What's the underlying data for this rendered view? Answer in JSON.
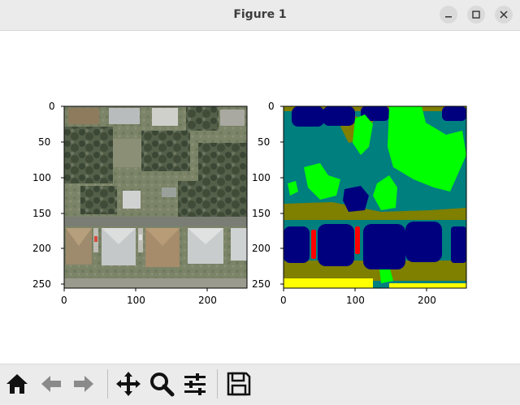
{
  "window": {
    "title": "Figure 1",
    "buttons": [
      "minimize",
      "maximize",
      "close"
    ]
  },
  "chart_data": [
    {
      "type": "image",
      "content": "aerial photo of residential neighborhood (houses, roofs, trees, lawns, road)",
      "x_ticks": [
        "0",
        "100",
        "200"
      ],
      "y_ticks": [
        "0",
        "50",
        "100",
        "150",
        "200",
        "250"
      ],
      "xlim": [
        0,
        255
      ],
      "ylim": [
        255,
        0
      ]
    },
    {
      "type": "image",
      "content": "semantic segmentation label map of the same scene",
      "colors": {
        "class_navy": "#00007f",
        "class_teal": "#007f7f",
        "class_olive": "#7f7f00",
        "class_lime": "#00ff00",
        "class_red": "#ff0000",
        "class_yellow": "#ffff00"
      },
      "x_ticks": [
        "0",
        "100",
        "200"
      ],
      "y_ticks": [
        "0",
        "50",
        "100",
        "150",
        "200",
        "250"
      ],
      "xlim": [
        0,
        255
      ],
      "ylim": [
        255,
        0
      ]
    }
  ],
  "toolbar": {
    "tools": [
      "home-icon",
      "back-icon",
      "forward-icon",
      "pan-icon",
      "zoom-icon",
      "configure-subplots-icon",
      "save-icon"
    ]
  }
}
